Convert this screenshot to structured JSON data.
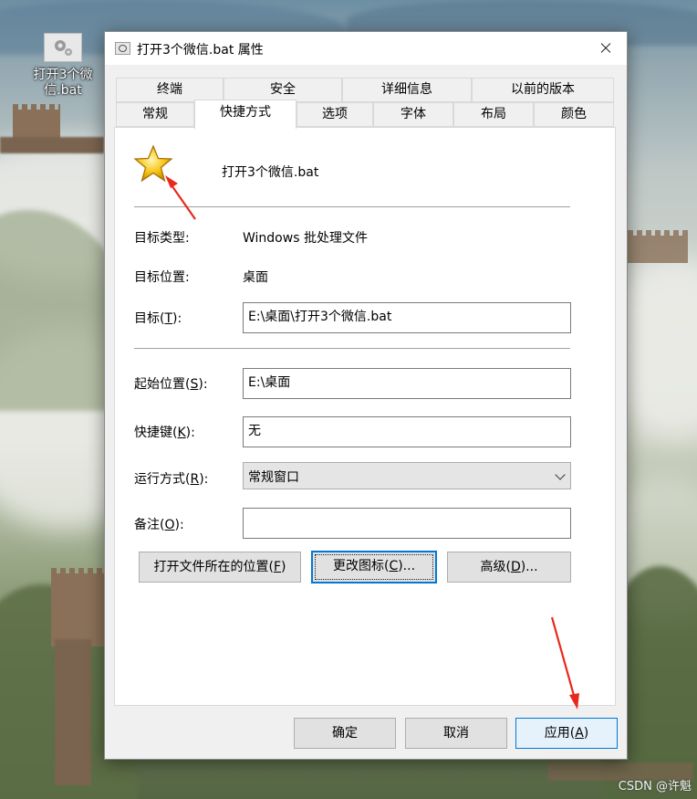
{
  "desktop": {
    "icon_label": "打开3个微信.bat",
    "watermark": "CSDN @许魁"
  },
  "dialog": {
    "title": "打开3个微信.bat 属性",
    "tabs_row1": [
      "终端",
      "安全",
      "详细信息",
      "以前的版本"
    ],
    "tabs_row2": [
      "常规",
      "快捷方式",
      "选项",
      "字体",
      "布局",
      "颜色"
    ],
    "active_tab": "快捷方式",
    "file_name": "打开3个微信.bat",
    "target_type_label": "目标类型:",
    "target_type_value": "Windows 批处理文件",
    "target_location_label": "目标位置:",
    "target_location_value": "桌面",
    "target_label": "目标(",
    "target_key": "T",
    "target_value": "E:\\桌面\\打开3个微信.bat",
    "start_in_label": "起始位置(",
    "start_in_key": "S",
    "start_in_value": "E:\\桌面",
    "shortcut_key_label": "快捷键(",
    "shortcut_key_key": "K",
    "shortcut_key_value": "无",
    "run_label": "运行方式(",
    "run_key": "R",
    "run_value": "常规窗口",
    "comment_label": "备注(",
    "comment_key": "O",
    "comment_value": "",
    "label_suffix": "):",
    "btn_open_location": "打开文件所在的位置(",
    "btn_open_location_key": "F",
    "btn_change_icon": "更改图标(",
    "btn_change_icon_key": "C",
    "btn_advanced": "高级(",
    "btn_advanced_key": "D",
    "btn_ellipsis_suffix": ")...",
    "btn_paren_suffix": ")",
    "ok": "确定",
    "cancel": "取消",
    "apply": "应用(",
    "apply_key": "A"
  },
  "colors": {
    "focus_blue": "#0078d7",
    "arrow_red": "#e8281c"
  },
  "icons": {
    "file_icon": "star-icon",
    "desktop_icon": "gears-icon"
  }
}
